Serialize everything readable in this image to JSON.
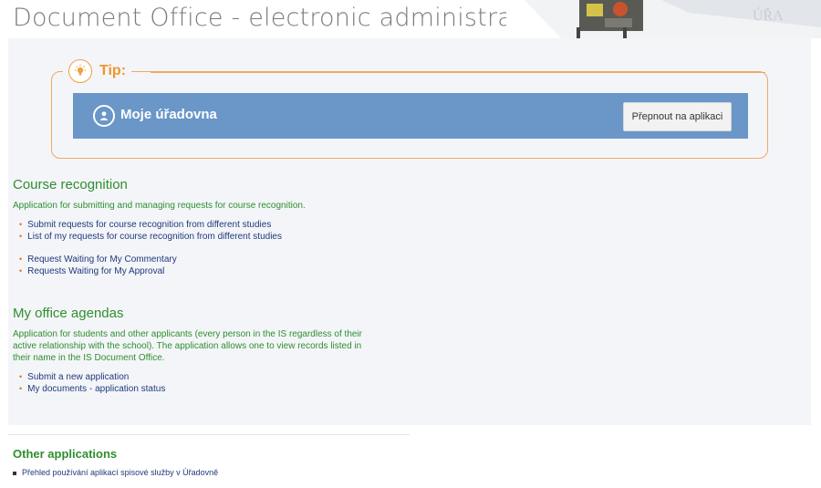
{
  "header": {
    "title": "Document Office - electronic administration"
  },
  "tip": {
    "label": "Tip:",
    "banner_title": "Moje úřadovna",
    "button_label": "Přepnout na aplikaci",
    "accent_color": "#f0952c",
    "banner_color": "#6a96c8"
  },
  "course_recognition": {
    "title": "Course recognition",
    "description": "Application for submitting and managing requests for course recognition.",
    "links_group1": [
      "Submit requests for course recognition from different studies",
      "List of my requests for course recognition from different studies"
    ],
    "links_group2": [
      "Request Waiting for My Commentary",
      "Requests Waiting for My Approval"
    ]
  },
  "my_office": {
    "title": "My office agendas",
    "description_lines": [
      "Application for students and other applicants (every person in the IS regardless of their",
      "active relationship with the school). The application allows one to view records listed in",
      "their name in the IS Document Office."
    ],
    "links": [
      "Submit a new application",
      "My documents - application status"
    ]
  },
  "other": {
    "title": "Other applications",
    "links": [
      "Přehled používání aplikací spisové služby v Úřadovně"
    ]
  }
}
